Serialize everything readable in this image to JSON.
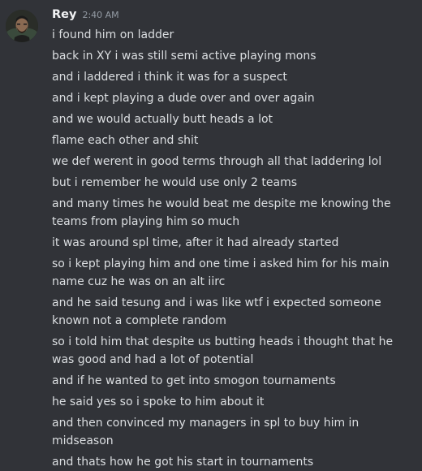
{
  "message": {
    "author": "Rey",
    "timestamp": "2:40 AM",
    "lines": [
      {
        "text": "i found him on ladder",
        "gap": 0
      },
      {
        "text": "back in XY i was still semi active playing mons",
        "gap": 4
      },
      {
        "text": "and i laddered i think it was for a suspect",
        "gap": 4
      },
      {
        "text": "and i kept playing a dude over and over again",
        "gap": 4
      },
      {
        "text": "and we would actually butt heads a lot",
        "gap": 4
      },
      {
        "text": "flame each other and shit",
        "gap": 4
      },
      {
        "text": "we def werent in good terms through all that laddering lol",
        "gap": 4
      },
      {
        "text": "but i remember he would use only 2 teams",
        "gap": 4
      },
      {
        "text": "and many times he would beat me despite me knowing the teams from playing him so much",
        "gap": 4
      },
      {
        "text": "it was around spl time, after it had already started",
        "gap": 4
      },
      {
        "text": "so i kept playing him and one time i asked him for his main name cuz he was on an alt iirc",
        "gap": 4
      },
      {
        "text": "and he said tesung and i was like wtf i expected someone known not a complete random",
        "gap": 4
      },
      {
        "text": "so i told him that despite us butting heads i thought that he was good and had a lot of potential",
        "gap": 4
      },
      {
        "text": "and if he wanted to get into smogon tournaments",
        "gap": 4
      },
      {
        "text": "he said yes so i spoke to him about it",
        "gap": 4
      },
      {
        "text": "and then convinced my managers in spl to buy him in midseason",
        "gap": 4
      },
      {
        "text": "and thats how he got his start in tournaments",
        "gap": 4
      }
    ]
  }
}
